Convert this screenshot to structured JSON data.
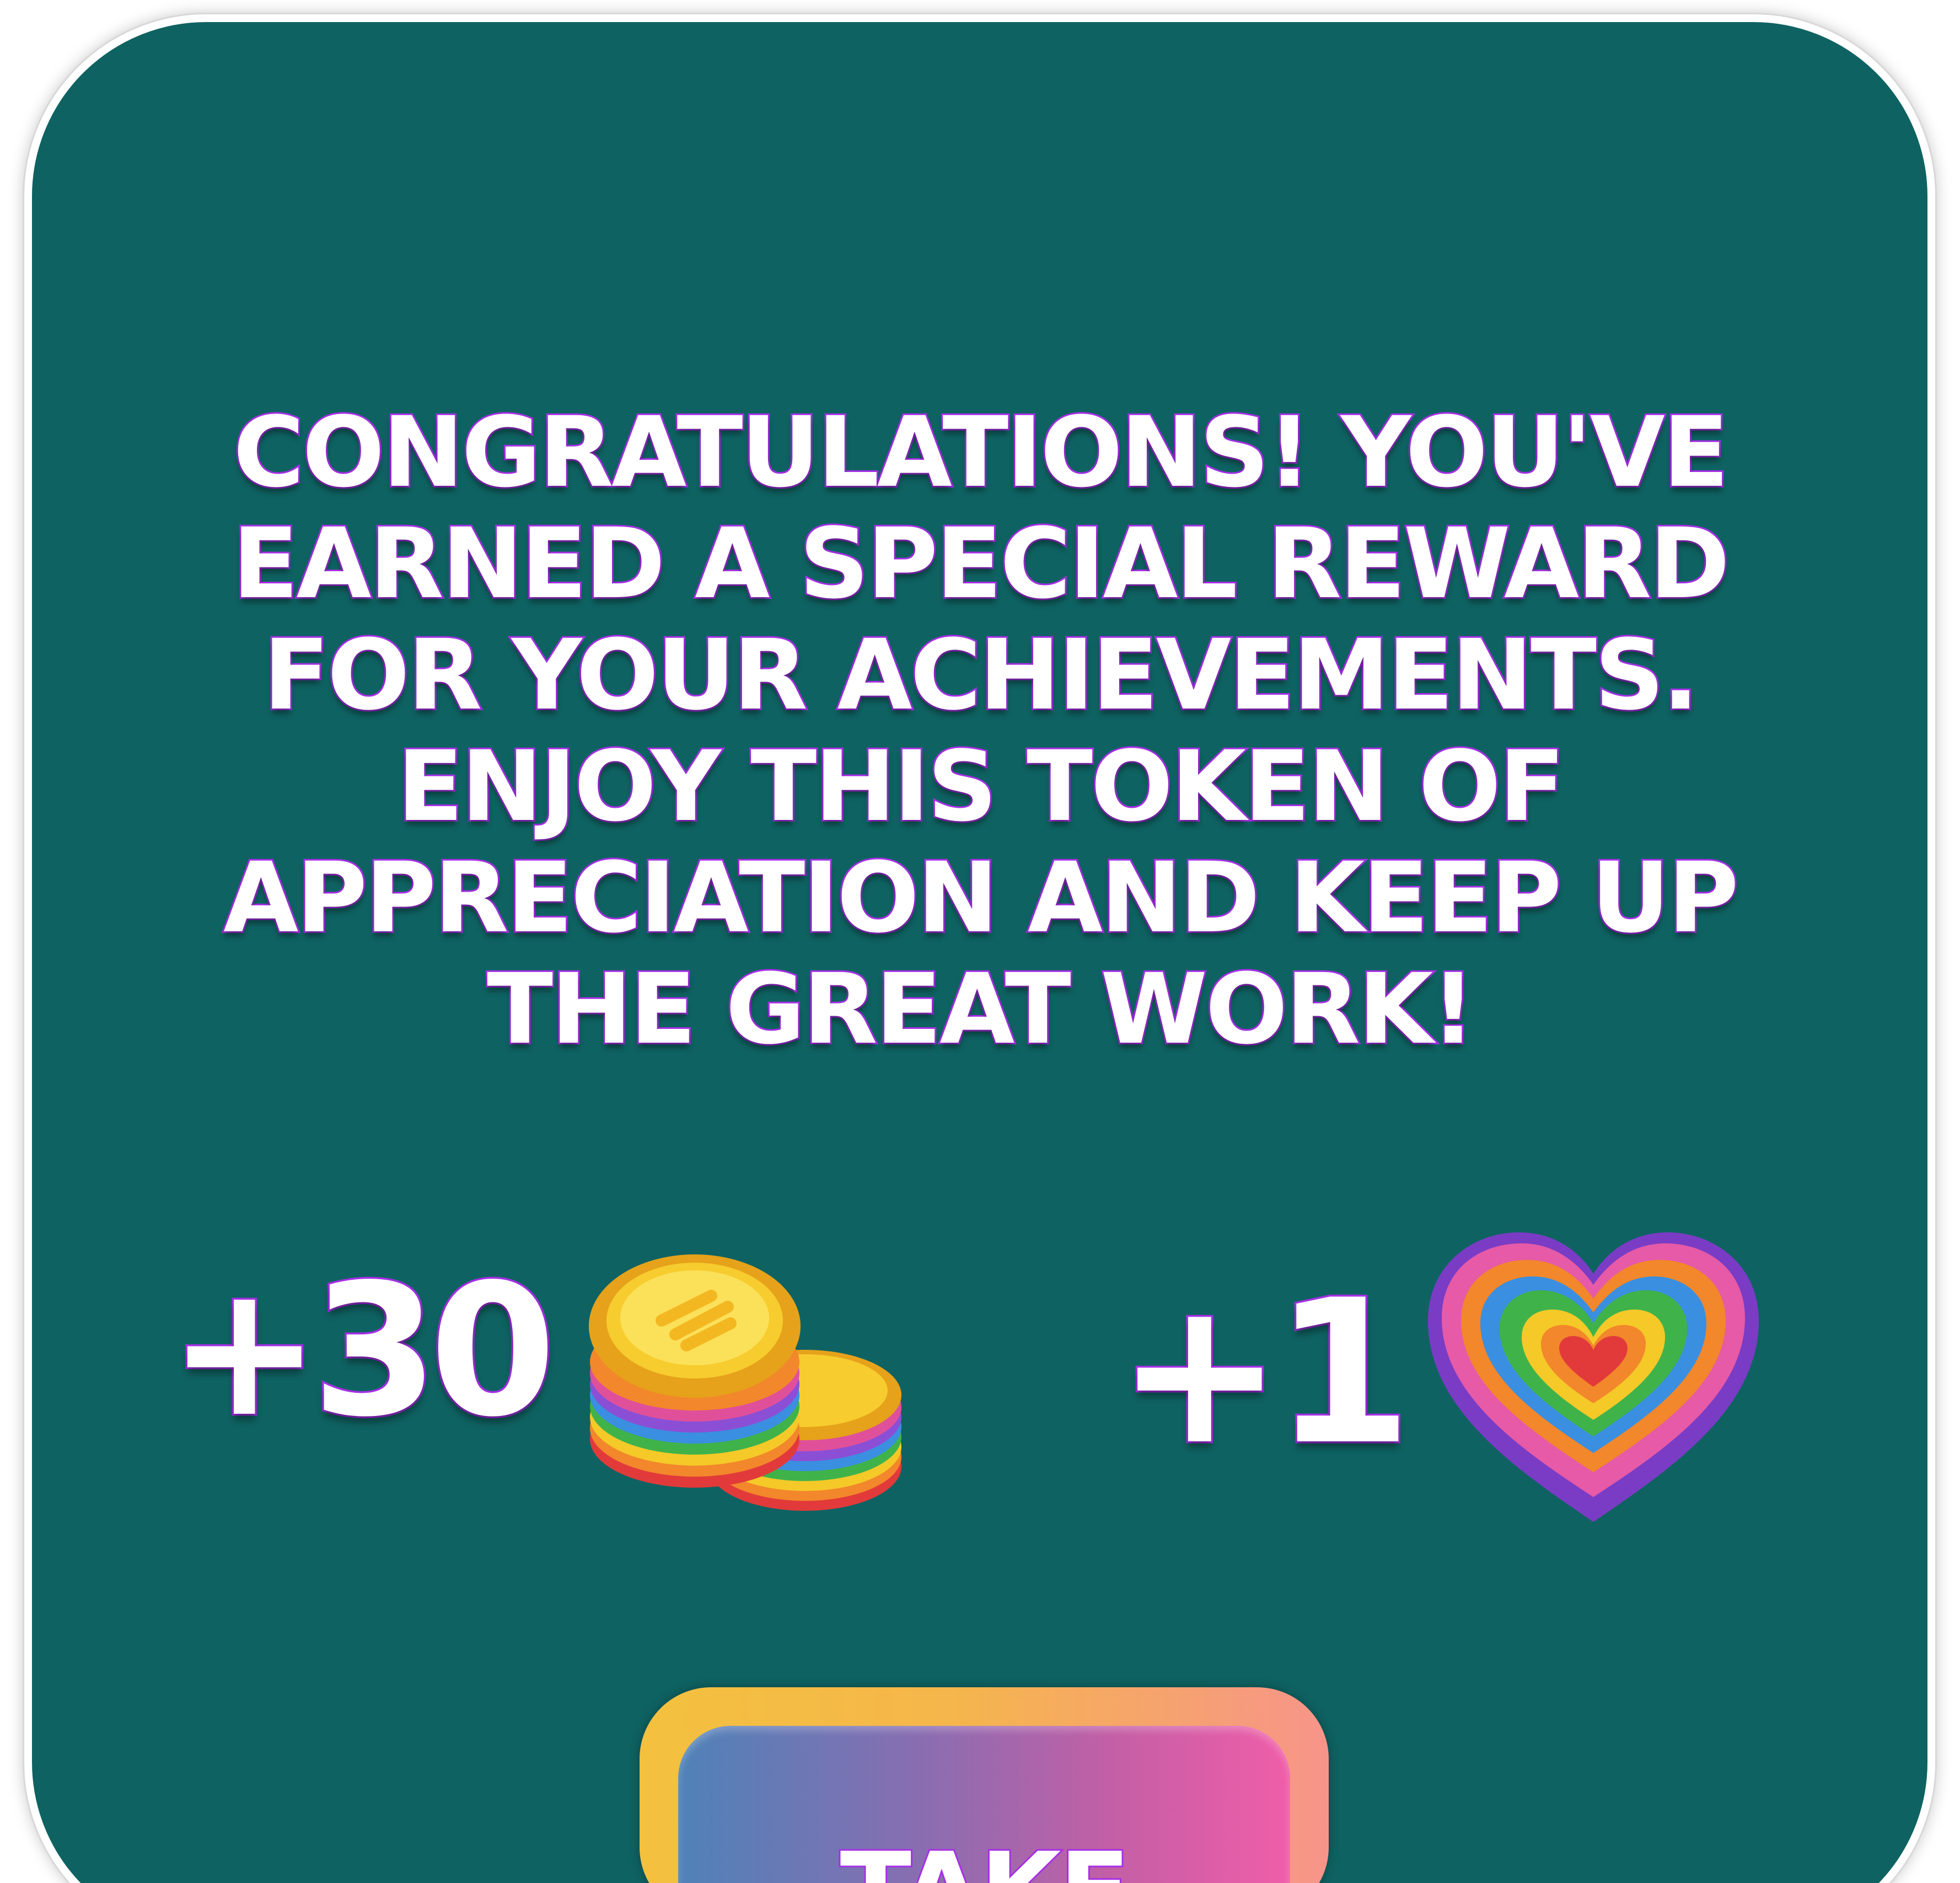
{
  "dialog": {
    "message": "CONGRATULATIONS! YOU'VE EARNED A SPECIAL REWARD FOR YOUR ACHIEVEMENTS. ENJOY THIS TOKEN OF APPRECIATION AND KEEP UP THE GREAT WORK!"
  },
  "rewards": [
    {
      "amount": "+30",
      "icon": "rainbow-coins-icon"
    },
    {
      "amount": "+1",
      "icon": "rainbow-heart-icon"
    }
  ],
  "take_button": {
    "label": "TAKE"
  },
  "colors": {
    "panel": "#0f6262",
    "text_outline": "#a62fe6",
    "button_frame": "#f4c13e",
    "button_fill_start": "#4f82b8",
    "button_fill_end": "#f05ea8"
  }
}
